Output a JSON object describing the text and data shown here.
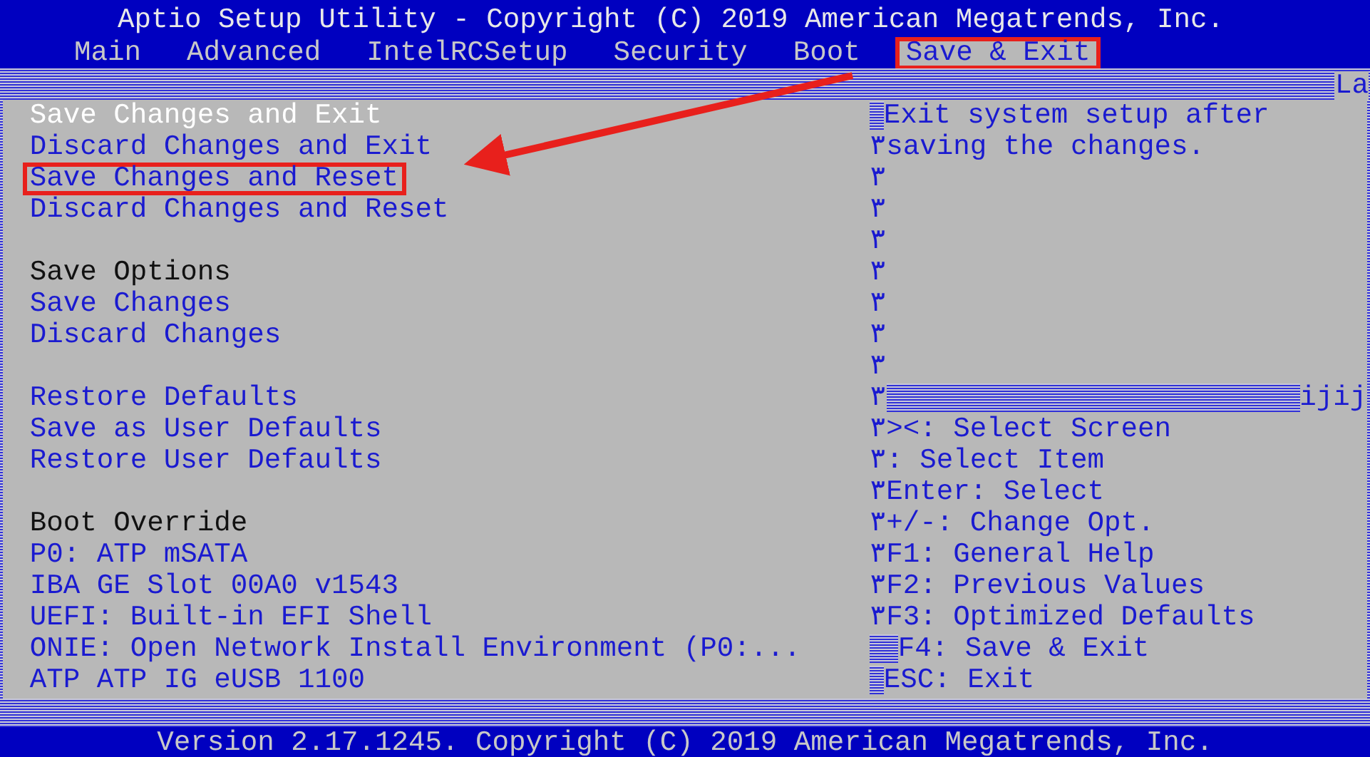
{
  "window": {
    "title": "Aptio Setup Utility - Copyright (C) 2019 American Megatrends, Inc."
  },
  "tabs": [
    {
      "label": "Main",
      "selected": false,
      "annotated": false
    },
    {
      "label": "Advanced",
      "selected": false,
      "annotated": false
    },
    {
      "label": "IntelRCSetup",
      "selected": false,
      "annotated": false
    },
    {
      "label": "Security",
      "selected": false,
      "annotated": false
    },
    {
      "label": "Boot",
      "selected": false,
      "annotated": false
    },
    {
      "label": "Save & Exit",
      "selected": true,
      "annotated": true
    }
  ],
  "corner_fragment": "La",
  "menu": [
    {
      "kind": "action",
      "label": "Save Changes and Exit",
      "selected": true,
      "annotated": false
    },
    {
      "kind": "action",
      "label": "Discard Changes and Exit",
      "selected": false,
      "annotated": false
    },
    {
      "kind": "action",
      "label": "Save Changes and Reset",
      "selected": false,
      "annotated": true
    },
    {
      "kind": "action",
      "label": "Discard Changes and Reset",
      "selected": false,
      "annotated": false
    },
    {
      "kind": "blank"
    },
    {
      "kind": "header",
      "label": "Save Options"
    },
    {
      "kind": "action",
      "label": "Save Changes",
      "selected": false,
      "annotated": false
    },
    {
      "kind": "action",
      "label": "Discard Changes",
      "selected": false,
      "annotated": false
    },
    {
      "kind": "blank"
    },
    {
      "kind": "action",
      "label": "Restore Defaults",
      "selected": false,
      "annotated": false
    },
    {
      "kind": "action",
      "label": "Save as User Defaults",
      "selected": false,
      "annotated": false
    },
    {
      "kind": "action",
      "label": "Restore User Defaults",
      "selected": false,
      "annotated": false
    },
    {
      "kind": "blank"
    },
    {
      "kind": "header",
      "label": "Boot Override"
    },
    {
      "kind": "action",
      "label": "P0: ATP mSATA",
      "selected": false,
      "annotated": false
    },
    {
      "kind": "action",
      "label": "IBA GE Slot 00A0 v1543",
      "selected": false,
      "annotated": false
    },
    {
      "kind": "action",
      "label": "UEFI: Built-in EFI Shell",
      "selected": false,
      "annotated": false
    },
    {
      "kind": "action",
      "label": "ONIE: Open Network Install Environment (P0:...",
      "selected": false,
      "annotated": false
    },
    {
      "kind": "action",
      "label": "ATP ATP IG eUSB 1100",
      "selected": false,
      "annotated": false
    }
  ],
  "help": [
    {
      "kind": "dithered",
      "text": "Exit system setup after"
    },
    {
      "kind": "line",
      "text": "٣saving the changes."
    },
    {
      "kind": "line",
      "text": "٣"
    },
    {
      "kind": "line",
      "text": "٣"
    },
    {
      "kind": "line",
      "text": "٣"
    },
    {
      "kind": "line",
      "text": "٣"
    },
    {
      "kind": "line",
      "text": "٣"
    },
    {
      "kind": "line",
      "text": "٣"
    },
    {
      "kind": "line",
      "text": "٣"
    },
    {
      "kind": "divider",
      "text": "٣",
      "end": "ijij"
    },
    {
      "kind": "line",
      "text": "٣><: Select Screen"
    },
    {
      "kind": "line",
      "text": "٣: Select Item"
    },
    {
      "kind": "line",
      "text": "٣Enter: Select"
    },
    {
      "kind": "line",
      "text": "٣+/-: Change Opt."
    },
    {
      "kind": "line",
      "text": "٣F1: General Help"
    },
    {
      "kind": "line",
      "text": "٣F2: Previous Values"
    },
    {
      "kind": "line",
      "text": "٣F3: Optimized Defaults"
    },
    {
      "kind": "wide-dithered",
      "text": "F4: Save & Exit"
    },
    {
      "kind": "dithered",
      "text": "ESC: Exit"
    }
  ],
  "status_bar": "Version 2.17.1245. Copyright (C) 2019 American Megatrends, Inc."
}
